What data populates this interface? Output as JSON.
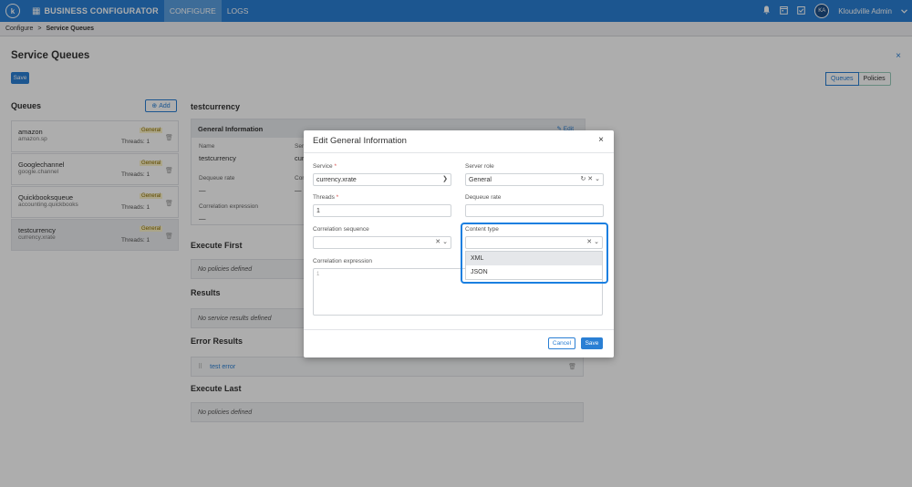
{
  "topbar": {
    "logo": "k",
    "brand": "BUSINESS CONFIGURATOR",
    "tabs": [
      "CONFIGURE",
      "LOGS"
    ],
    "avatar": "KA",
    "user": "Kloudville Admin"
  },
  "breadcrumb": {
    "root": "Configure",
    "sep": ">",
    "current": "Service Queues"
  },
  "page": {
    "title": "Service Queues",
    "save": "Save",
    "toggle": [
      "Queues",
      "Policies"
    ],
    "close": "×"
  },
  "queues": {
    "title": "Queues",
    "add_label": "Add",
    "items": [
      {
        "name": "amazon",
        "sub": "amazon.sp",
        "badge": "General",
        "threads": "Threads: 1"
      },
      {
        "name": "Googlechannel",
        "sub": "google.channel",
        "badge": "General",
        "threads": "Threads: 1"
      },
      {
        "name": "Quickbooksqueue",
        "sub": "accounting.quickbooks",
        "badge": "General",
        "threads": "Threads: 1"
      },
      {
        "name": "testcurrency",
        "sub": "currency.xrate",
        "badge": "General",
        "threads": "Threads: 1"
      }
    ]
  },
  "detail": {
    "title": "testcurrency",
    "general_info": "General Information",
    "edit": "Edit",
    "name_label": "Name",
    "name_value": "testcurrency",
    "service_label_partial": "Ser",
    "service_value_partial": "cur",
    "dequeue_label": "Dequeue rate",
    "dequeue_value": "—",
    "cor_partial": "Cor",
    "cor_value": "—",
    "correlation_label": "Correlation expression",
    "correlation_value": "—",
    "execute_first": "Execute First",
    "no_policies": "No policies defined",
    "results": "Results",
    "no_results": "No service results defined",
    "error_results": "Error Results",
    "error_item": "test error",
    "execute_last": "Execute Last",
    "no_policies_last": "No policies defined"
  },
  "modal": {
    "title": "Edit General Information",
    "close": "×",
    "service_label": "Service",
    "service_value": "currency.xrate",
    "server_role_label": "Server role",
    "server_role_value": "General",
    "threads_label": "Threads",
    "threads_value": "1",
    "dequeue_label": "Dequeue rate",
    "dequeue_value": "",
    "corr_seq_label": "Correlation sequence",
    "corr_seq_value": "",
    "content_type_label": "Content type",
    "content_type_value": "",
    "corr_expr_label": "Correlation expression",
    "corr_expr_line": "1",
    "content_type_options": [
      "XML",
      "JSON"
    ],
    "cancel": "Cancel",
    "save": "Save",
    "required_mark": "*"
  },
  "icons": {
    "chevron": "chevron-down-icon",
    "clear": "clear-icon",
    "refresh": "refresh-icon",
    "delete": "trash-icon"
  },
  "colors": {
    "primary": "#2a7fd4",
    "highlight": "#1a7fe0",
    "badge_bg": "#fdf3c9"
  }
}
